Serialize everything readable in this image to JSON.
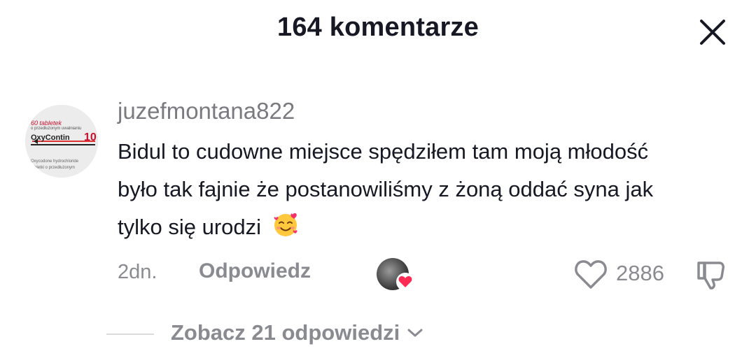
{
  "header": {
    "title": "164 komentarze",
    "close_icon": "close-icon"
  },
  "comment": {
    "avatar": {
      "line1": "60 tabletek",
      "line2": "o przedłużonym uwalnianiu",
      "brand": "OxyContin",
      "dose": "10",
      "line3": "Oxycodone hydrochloride",
      "line4": "tabletki o przedłużonym"
    },
    "username": "juzefmontana822",
    "text": "Bidul to cudowne miejsce spędziłem tam moją młodość było tak fajnie że postanowiliśmy z żoną oddać syna jak tylko się urodzi",
    "emoji": "smiling-face-with-hearts",
    "time": "2dn.",
    "reply_label": "Odpowiedz",
    "creator_liked_icon": "heart-icon",
    "like_count": "2886",
    "like_icon": "heart-outline-icon",
    "dislike_icon": "thumbs-down-icon"
  },
  "replies": {
    "label": "Zobacz 21 odpowiedzi",
    "icon": "chevron-down-icon"
  },
  "colors": {
    "text": "#161823",
    "muted": "#8a8b91",
    "heart": "#fe2c55"
  }
}
